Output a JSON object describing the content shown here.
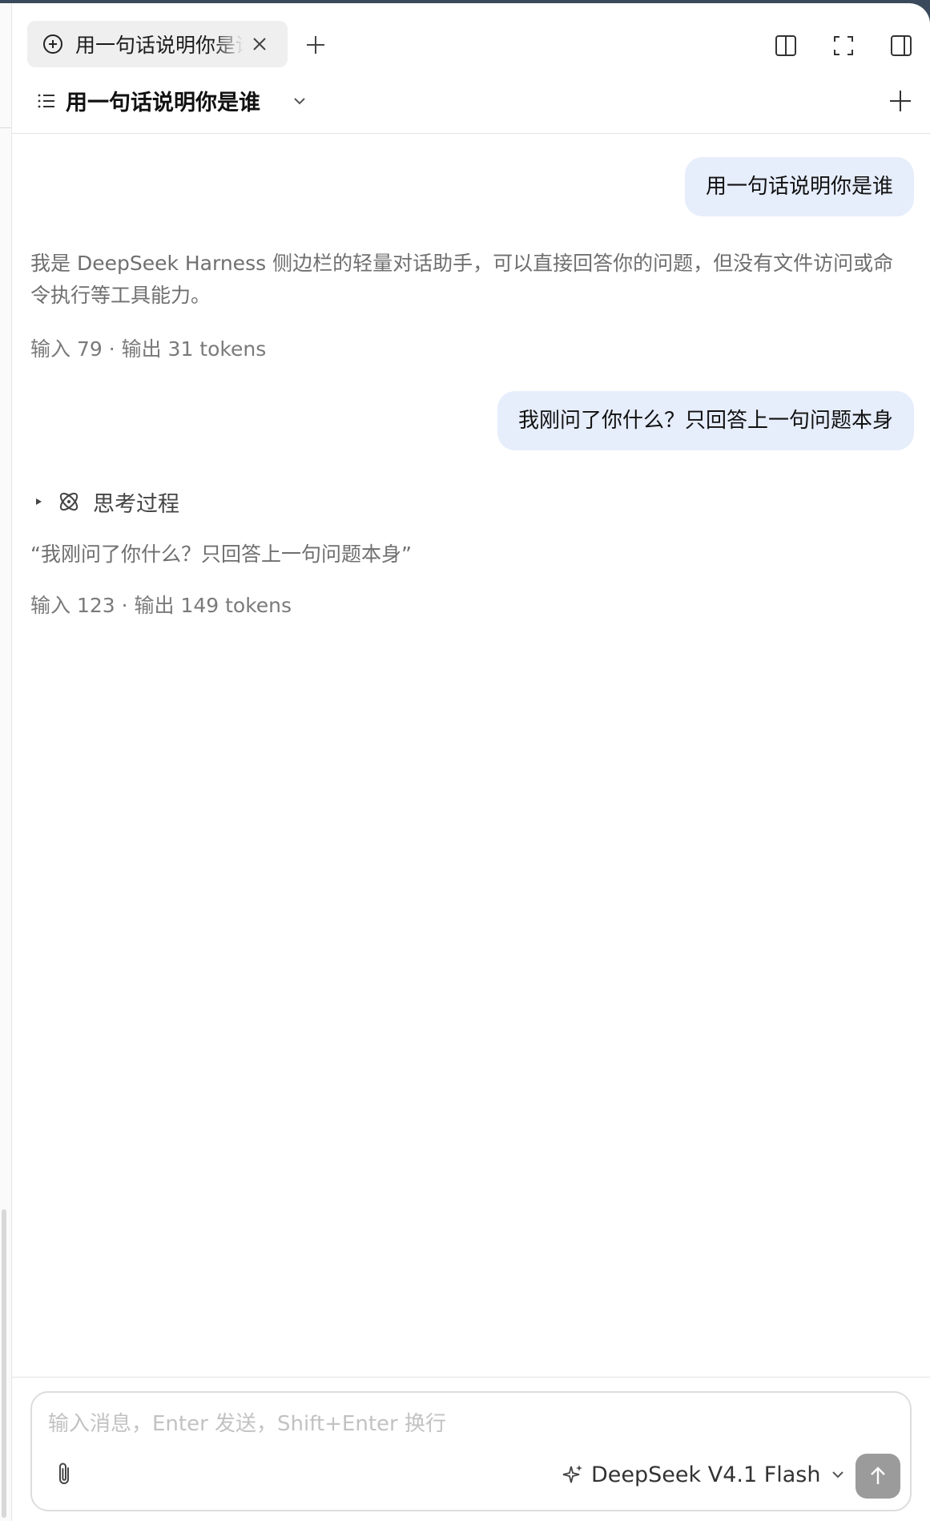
{
  "tab": {
    "title": "用一句话说明你是谁",
    "icons": [
      "plus-circle-icon",
      "close-icon",
      "plus-icon"
    ]
  },
  "toolbar": {
    "icons": [
      "split-view-icon",
      "fullscreen-icon",
      "sidebar-toggle-icon"
    ]
  },
  "header": {
    "title": "用一句话说明你是谁",
    "icons": [
      "list-icon",
      "chevron-down-icon",
      "plus-icon"
    ]
  },
  "messages": [
    {
      "role": "user",
      "text": "用一句话说明你是谁"
    },
    {
      "role": "assistant",
      "text": "我是 DeepSeek Harness 侧边栏的轻量对话助手，可以直接回答你的问题，但没有文件访问或命令执行等工具能力。",
      "usage": "输入 79 · 输出 31 tokens"
    },
    {
      "role": "user",
      "text": "我刚问了你什么？只回答上一句问题本身"
    },
    {
      "role": "assistant",
      "thinking_label": "思考过程",
      "text": "“我刚问了你什么？只回答上一句问题本身”",
      "usage": "输入 123 · 输出 149 tokens"
    }
  ],
  "composer": {
    "placeholder": "输入消息，Enter 发送，Shift+Enter 换行",
    "value": "",
    "model": "DeepSeek V4.1 Flash",
    "icons": [
      "paperclip-icon",
      "sparkle-icon",
      "chevron-down-icon",
      "arrow-up-icon"
    ]
  },
  "colors": {
    "user_bubble": "#e6edfb",
    "send_button": "#9b9b9b",
    "secondary_text": "#6f6f6f"
  }
}
